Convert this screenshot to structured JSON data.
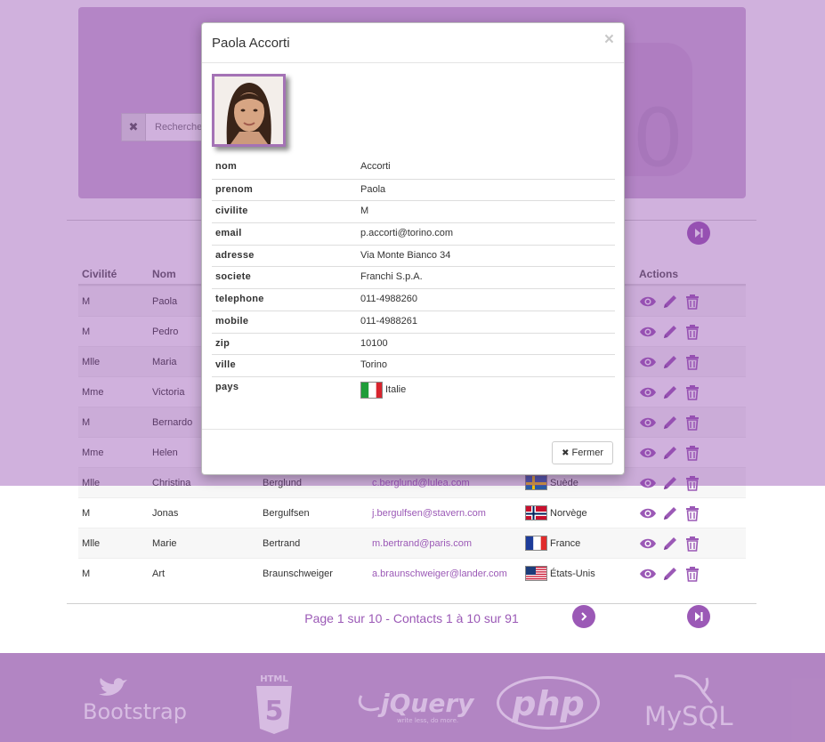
{
  "search": {
    "placeholder": "Recherche"
  },
  "table": {
    "headers": {
      "civilite": "Civilité",
      "nom": "Nom",
      "actions": "Actions"
    },
    "rows": [
      {
        "civ": "M",
        "nom": "Paola",
        "prenom": "",
        "email": "",
        "pays": ""
      },
      {
        "civ": "M",
        "nom": "Pedro",
        "prenom": "",
        "email": "",
        "pays": ""
      },
      {
        "civ": "Mlle",
        "nom": "Maria",
        "prenom": "",
        "email": "",
        "pays": ""
      },
      {
        "civ": "Mme",
        "nom": "Victoria",
        "prenom": "",
        "email": "",
        "pays": ""
      },
      {
        "civ": "M",
        "nom": "Bernardo",
        "prenom": "",
        "email": "",
        "pays": ""
      },
      {
        "civ": "Mme",
        "nom": "Helen",
        "prenom": "",
        "email": "",
        "pays": ""
      },
      {
        "civ": "Mlle",
        "nom": "Christina",
        "prenom": "Berglund",
        "email": "c.berglund@lulea.com",
        "pays": "Suède"
      },
      {
        "civ": "M",
        "nom": "Jonas",
        "prenom": "Bergulfsen",
        "email": "j.bergulfsen@stavern.com",
        "pays": "Norvège"
      },
      {
        "civ": "Mlle",
        "nom": "Marie",
        "prenom": "Bertrand",
        "email": "m.bertrand@paris.com",
        "pays": "France"
      },
      {
        "civ": "M",
        "nom": "Art",
        "prenom": "Braunschweiger",
        "email": "a.braunschweiger@lander.com",
        "pays": "États-Unis"
      }
    ]
  },
  "pagination": {
    "info": "Page 1 sur 10 - Contacts 1 à 10 sur 91"
  },
  "footer": {
    "logos": [
      "Bootstrap",
      "HTML",
      "5",
      "jQuery",
      "write less, do more.",
      "php",
      "MySQL"
    ]
  },
  "modal": {
    "title": "Paola Accorti",
    "close_symbol": "×",
    "close_button": "Fermer",
    "fields": [
      {
        "key": "nom",
        "value": "Accorti"
      },
      {
        "key": "prenom",
        "value": "Paola"
      },
      {
        "key": "civilite",
        "value": "M"
      },
      {
        "key": "email",
        "value": "p.accorti@torino.com"
      },
      {
        "key": "adresse",
        "value": "Via Monte Bianco 34"
      },
      {
        "key": "societe",
        "value": "Franchi S.p.A."
      },
      {
        "key": "telephone",
        "value": "011-4988260"
      },
      {
        "key": "mobile",
        "value": "011-4988261"
      },
      {
        "key": "zip",
        "value": "10100"
      },
      {
        "key": "ville",
        "value": "Torino"
      },
      {
        "key": "pays",
        "value": "Italie"
      }
    ]
  },
  "colors": {
    "accent": "#9b59b6",
    "footer": "#b991c7",
    "overlay": "#8e44ad"
  }
}
